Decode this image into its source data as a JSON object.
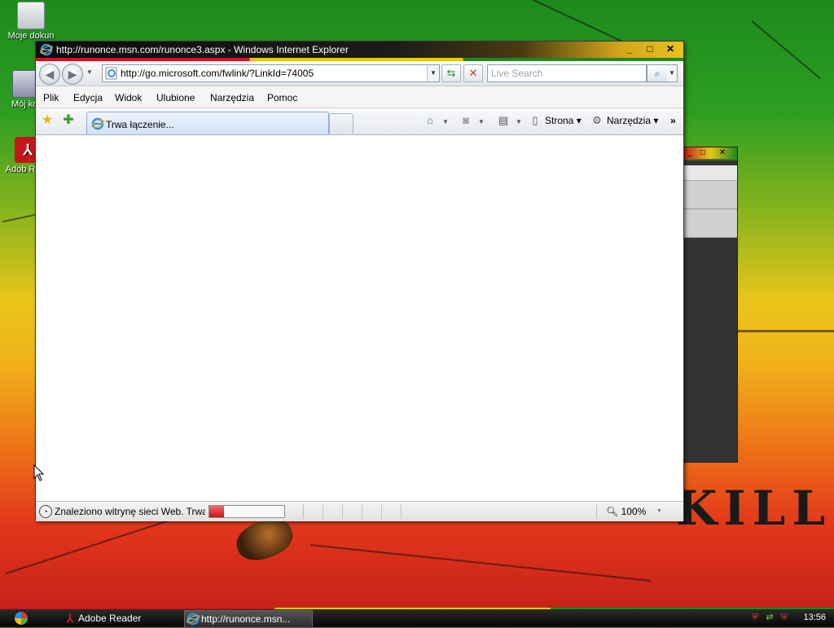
{
  "desktop": {
    "icons": [
      {
        "label": "Moje dokun"
      },
      {
        "label": "Mój kor"
      },
      {
        "label": "Adob Reac"
      }
    ],
    "wallpaper_text": "KILL",
    "colors": {
      "red": "#c21b1b",
      "yellow": "#e9c51a",
      "green": "#1d8a1d"
    }
  },
  "background_window": {
    "minimize": "_",
    "maximize": "□",
    "close": "✕"
  },
  "ie_window": {
    "title": "http://runonce.msn.com/runonce3.aspx - Windows Internet Explorer",
    "controls": {
      "minimize": "_",
      "maximize": "□",
      "close": "✕"
    },
    "address": {
      "url": "http://go.microsoft.com/fwlink/?LinkId=74005"
    },
    "search": {
      "placeholder": "Live Search"
    },
    "menu": [
      "Plik",
      "Edycja",
      "Widok",
      "Ulubione",
      "Narzędzia",
      "Pomoc"
    ],
    "tab": {
      "label": "Trwa łączenie..."
    },
    "command_bar": {
      "page_label": "Strona",
      "tools_label": "Narzędzia",
      "more": "»"
    },
    "status": {
      "text": "Znaleziono witrynę sieci Web. Trwa",
      "progress": 0.2,
      "zoom": "100%"
    }
  },
  "taskbar": {
    "buttons": [
      {
        "label": "Adobe Reader"
      },
      {
        "label": "http://runonce.msn..."
      }
    ],
    "clock": "13:56"
  }
}
